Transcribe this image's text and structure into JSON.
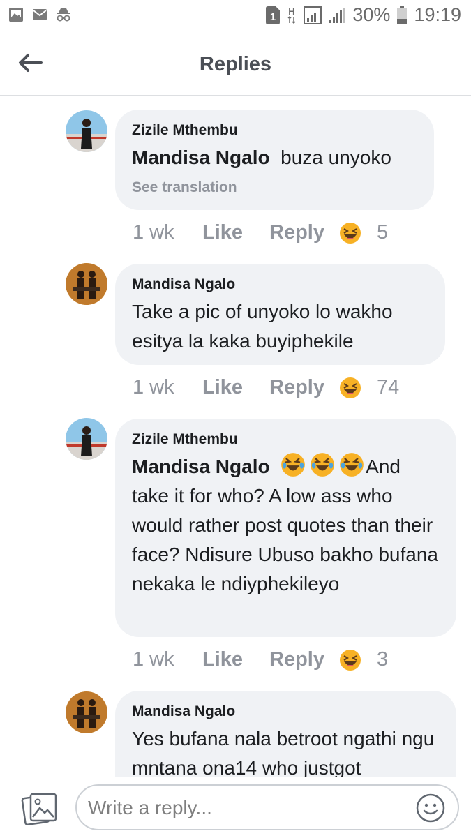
{
  "status_bar": {
    "battery_percent": "30%",
    "time": "19:19",
    "sim_label": "1",
    "network_label": "H"
  },
  "header": {
    "title": "Replies"
  },
  "comments": [
    {
      "author": "Zizile Mthembu",
      "mention": "Mandisa Ngalo",
      "text": "buza unyoko",
      "translation": "See translation",
      "time": "1 wk",
      "like": "Like",
      "reply": "Reply",
      "reaction_count": "5"
    },
    {
      "author": "Mandisa Ngalo",
      "text": "Take a pic of unyoko lo wakho esitya la kaka buyiphekile",
      "time": "1 wk",
      "like": "Like",
      "reply": "Reply",
      "reaction_count": "74"
    },
    {
      "author": "Zizile Mthembu",
      "mention": "Mandisa Ngalo",
      "text": "And take it for who? A low ass who would  rather post quotes  than their face? Ndisure Ubuso bakho bufana nekaka le ndiyphekileyo",
      "time": "1 wk",
      "like": "Like",
      "reply": "Reply",
      "reaction_count": "3"
    },
    {
      "author": "Mandisa Ngalo",
      "text": "Yes bufana nala betroot ngathi ngu mntana ona14 who justgot"
    }
  ],
  "composer": {
    "placeholder": "Write a reply..."
  },
  "colors": {
    "bubble": "#f0f2f5",
    "muted": "#90949c",
    "title": "#4b4f56",
    "laugh_emoji": "#f7b125"
  }
}
